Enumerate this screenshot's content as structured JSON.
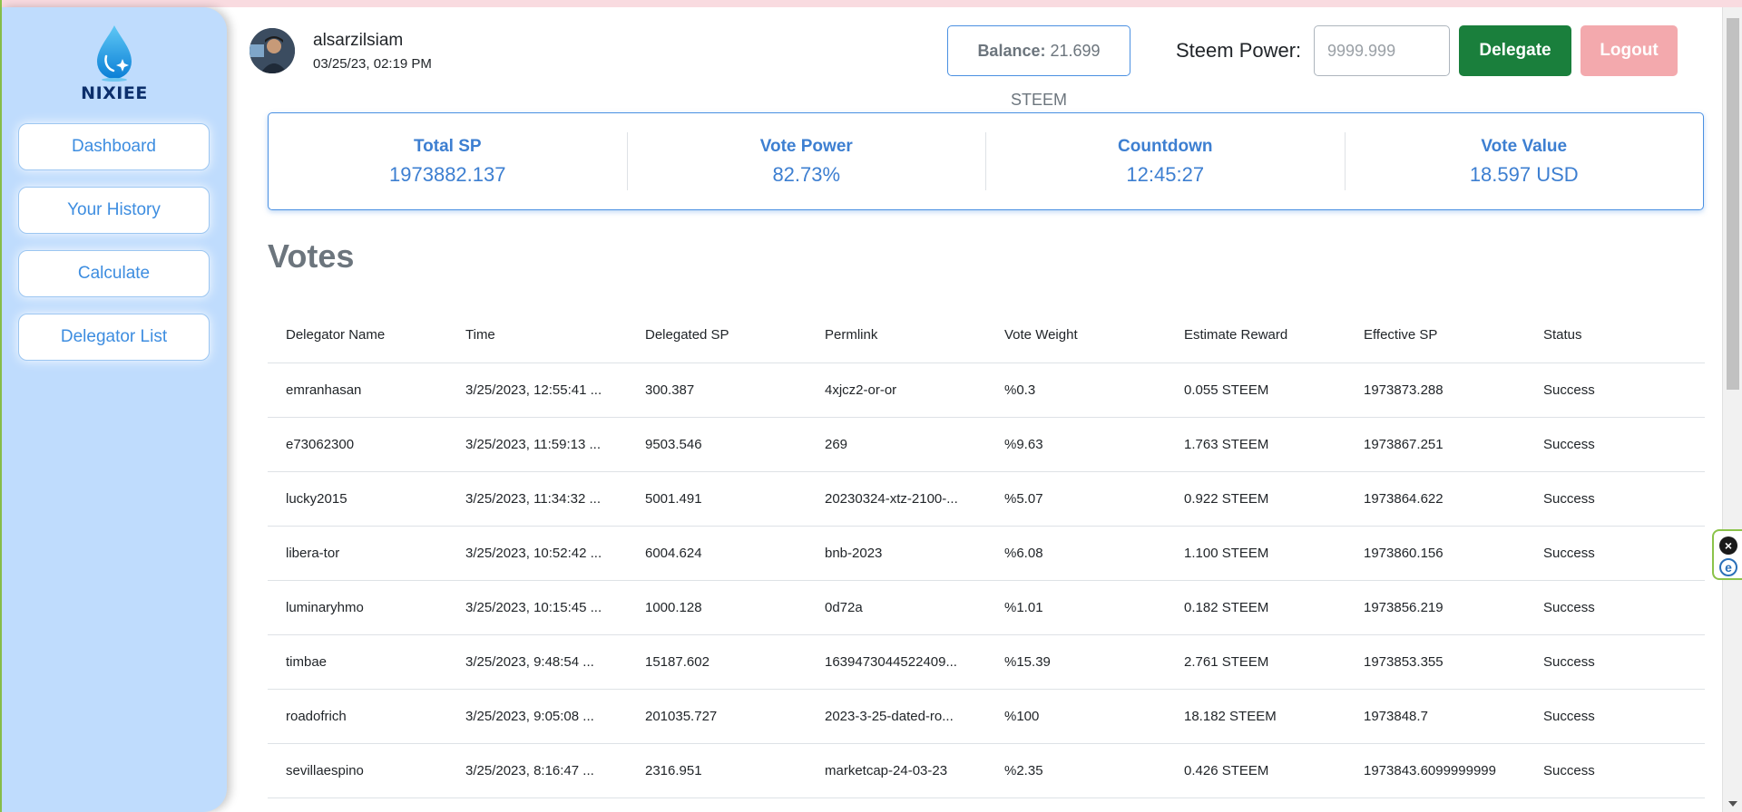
{
  "app": {
    "brand": "NIXIEE"
  },
  "sidebar": {
    "items": [
      {
        "label": "Dashboard"
      },
      {
        "label": "Your History"
      },
      {
        "label": "Calculate"
      },
      {
        "label": "Delegator List"
      }
    ]
  },
  "header": {
    "username": "alsarzilsiam",
    "datetime": "03/25/23, 02:19 PM",
    "balance_label": "Balance:",
    "balance_value": "21.699 STEEM",
    "steem_power_label": "Steem Power:",
    "steem_power_placeholder": "9999.999",
    "delegate_label": "Delegate",
    "logout_label": "Logout"
  },
  "stats": [
    {
      "label": "Total SP",
      "value": "1973882.137"
    },
    {
      "label": "Vote Power",
      "value": "82.73%"
    },
    {
      "label": "Countdown",
      "value": "12:45:27"
    },
    {
      "label": "Vote Value",
      "value": "18.597 USD"
    }
  ],
  "votes": {
    "title": "Votes",
    "columns": [
      "Delegator Name",
      "Time",
      "Delegated SP",
      "Permlink",
      "Vote Weight",
      "Estimate Reward",
      "Effective SP",
      "Status"
    ],
    "rows": [
      {
        "delegator": "emranhasan",
        "time": "3/25/2023, 12:55:41 ...",
        "delegated_sp": "300.387",
        "permlink": "4xjcz2-or-or",
        "vote_weight": "%0.3",
        "estimate_reward": "0.055 STEEM",
        "effective_sp": "1973873.288",
        "status": "Success"
      },
      {
        "delegator": "e73062300",
        "time": "3/25/2023, 11:59:13 ...",
        "delegated_sp": "9503.546",
        "permlink": "269",
        "vote_weight": "%9.63",
        "estimate_reward": "1.763 STEEM",
        "effective_sp": "1973867.251",
        "status": "Success"
      },
      {
        "delegator": "lucky2015",
        "time": "3/25/2023, 11:34:32 ...",
        "delegated_sp": "5001.491",
        "permlink": "20230324-xtz-2100-...",
        "vote_weight": "%5.07",
        "estimate_reward": "0.922 STEEM",
        "effective_sp": "1973864.622",
        "status": "Success"
      },
      {
        "delegator": "libera-tor",
        "time": "3/25/2023, 10:52:42 ...",
        "delegated_sp": "6004.624",
        "permlink": "bnb-2023",
        "vote_weight": "%6.08",
        "estimate_reward": "1.100 STEEM",
        "effective_sp": "1973860.156",
        "status": "Success"
      },
      {
        "delegator": "luminaryhmo",
        "time": "3/25/2023, 10:15:45 ...",
        "delegated_sp": "1000.128",
        "permlink": "0d72a",
        "vote_weight": "%1.01",
        "estimate_reward": "0.182 STEEM",
        "effective_sp": "1973856.219",
        "status": "Success"
      },
      {
        "delegator": "timbae",
        "time": "3/25/2023, 9:48:54 ...",
        "delegated_sp": "15187.602",
        "permlink": "1639473044522409...",
        "vote_weight": "%15.39",
        "estimate_reward": "2.761 STEEM",
        "effective_sp": "1973853.355",
        "status": "Success"
      },
      {
        "delegator": "roadofrich",
        "time": "3/25/2023, 9:05:08 ...",
        "delegated_sp": "201035.727",
        "permlink": "2023-3-25-dated-ro...",
        "vote_weight": "%100",
        "estimate_reward": "18.182 STEEM",
        "effective_sp": "1973848.7",
        "status": "Success"
      },
      {
        "delegator": "sevillaespino",
        "time": "3/25/2023, 8:16:47 ...",
        "delegated_sp": "2316.951",
        "permlink": "marketcap-24-03-23",
        "vote_weight": "%2.35",
        "estimate_reward": "0.426 STEEM",
        "effective_sp": "1973843.6099999999",
        "status": "Success"
      }
    ]
  },
  "colors": {
    "sidebar_bg": "#bfdcfd",
    "accent_blue": "#3d7fd1",
    "delegate_green": "#1a7f3c",
    "logout_pink": "#f3a9ad",
    "permlink_green": "#1a8f5c"
  },
  "icons": {
    "logo": "water-drop-icon",
    "extension_close": "close-icon",
    "extension_e": "e-icon"
  }
}
